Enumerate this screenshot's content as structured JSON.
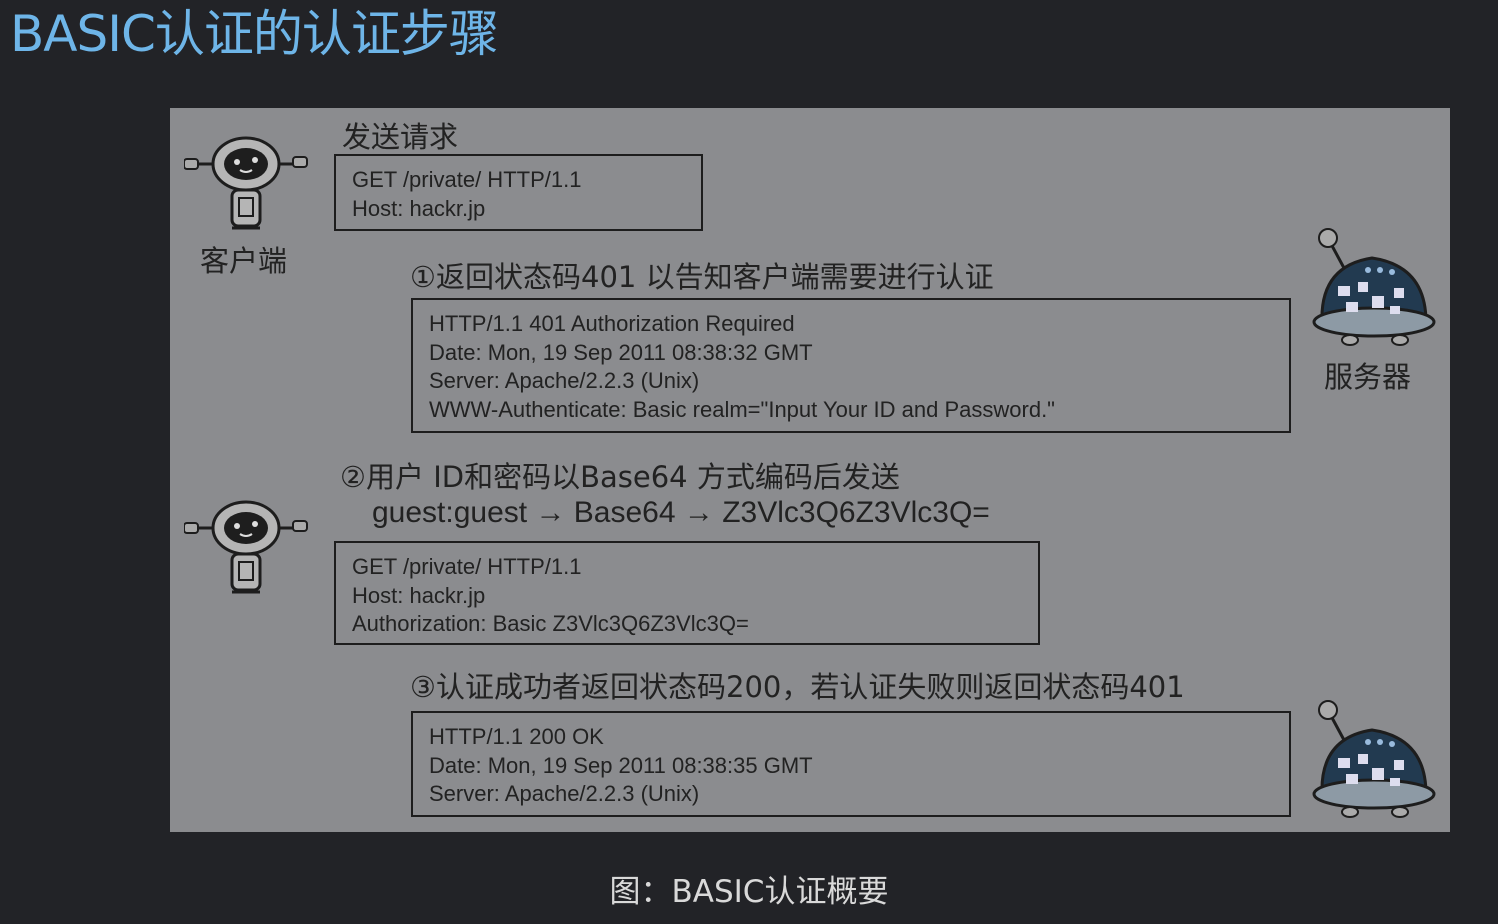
{
  "page_title": "BASIC认证的认证步骤",
  "figure": {
    "send_request_label": "发送请求",
    "client_label": "客户端",
    "server_label": "服务器",
    "request1": [
      "GET /private/ HTTP/1.1",
      "Host: hackr.jp"
    ],
    "step1": "①返回状态码401 以告知客户端需要进行认证",
    "response1": [
      "HTTP/1.1 401 Authorization Required",
      "Date: Mon, 19 Sep 2011 08:38:32 GMT",
      "Server: Apache/2.2.3 (Unix)",
      "WWW-Authenticate: Basic realm=\"Input Your ID and Password.\""
    ],
    "step2": "②用户 ID和密码以Base64 方式编码后发送",
    "encode_line": "guest:guest → Base64 → Z3Vlc3Q6Z3Vlc3Q=",
    "request2": [
      "GET /private/ HTTP/1.1",
      "Host: hackr.jp",
      "Authorization: Basic Z3Vlc3Q6Z3Vlc3Q="
    ],
    "step3": "③认证成功者返回状态码200，若认证失败则返回状态码401",
    "response2": [
      "HTTP/1.1 200 OK",
      "Date: Mon, 19 Sep 2011 08:38:35 GMT",
      "Server: Apache/2.2.3 (Unix)"
    ]
  },
  "caption": "图：BASIC认证概要",
  "icons": [
    "client-robot-icon",
    "server-robot-icon"
  ]
}
